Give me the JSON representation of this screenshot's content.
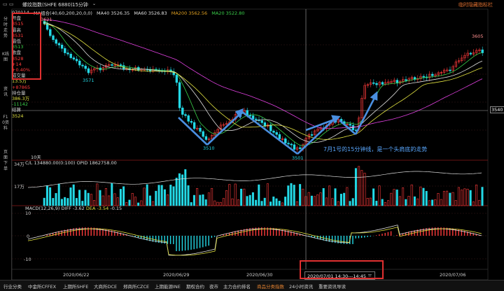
{
  "topbar": {
    "title": "螺纹指数(SHFE 6880)",
    "period": "15分钟",
    "right_link": "临时隐藏指标栏"
  },
  "left_tabs": [
    "分时走势",
    "K线图",
    "资讯",
    "F10资料",
    "页面下单"
  ],
  "info": {
    "code": "070114",
    "open_label": "开盘",
    "open": "3515",
    "high_label": "最高",
    "high": "3531",
    "low_label": "最低",
    "low": "3513",
    "close_label": "收盘",
    "close": "3528",
    "change": "+14",
    "change_pct": "+0.40%",
    "volume_label": "成交量",
    "volume": "13.5万",
    "vol_change": "+87865",
    "oi_label": "持仓量",
    "oi": "386.3万",
    "oi_change": "-11142",
    "settle_label": "结算",
    "settle": "3524",
    "days": "10天"
  },
  "ma_legend": {
    "main": "MA组合(40,60,200,20,0,0)",
    "ma40": "MA40 3526.35",
    "ma60": "MA60 3526.83",
    "ma200": "MA200 3562.56",
    "ma20": "MA20 3522.80"
  },
  "price_labels": {
    "p3621": "3621",
    "p3571": "3571",
    "p3540": "3540",
    "p3510": "3510",
    "p3501": "3501",
    "p3605": "3605"
  },
  "annotation": "7月1号的15分钟线，是一个头肩底的走势",
  "volume_legend": {
    "ciL": "C/L",
    "vol": "134880.00(0:100)",
    "opid": "OPID 1862758.00",
    "y34": "34万",
    "y17": "17万"
  },
  "macd_legend": {
    "macd": "MACD(12,26,9)",
    "diff": "DIFF -3.62",
    "dea": "DEA -3.54",
    "macd_val": "-0.15",
    "y10": "10",
    "y0": "0",
    "yn10": "-10"
  },
  "dates": [
    "2020/06/22",
    "2020/06/29",
    "2020/06/30",
    "2020/07/06"
  ],
  "time_box": "2020/07/01 14:30---14:45 三",
  "bottom_tabs": [
    "行业分类",
    "中金所CFFEX",
    "上期所SHFE",
    "大商所DCE",
    "郑商所CZCE",
    "上期能源INE",
    "期权合约",
    "夜市",
    "主力合约排名",
    "商品分类指数",
    "24小时资讯",
    "重要资讯导读"
  ],
  "colors": {
    "up": "#ff3b3b",
    "down": "#23d9e6",
    "accent": "#e03030",
    "arrow": "#4a8fe0"
  }
}
